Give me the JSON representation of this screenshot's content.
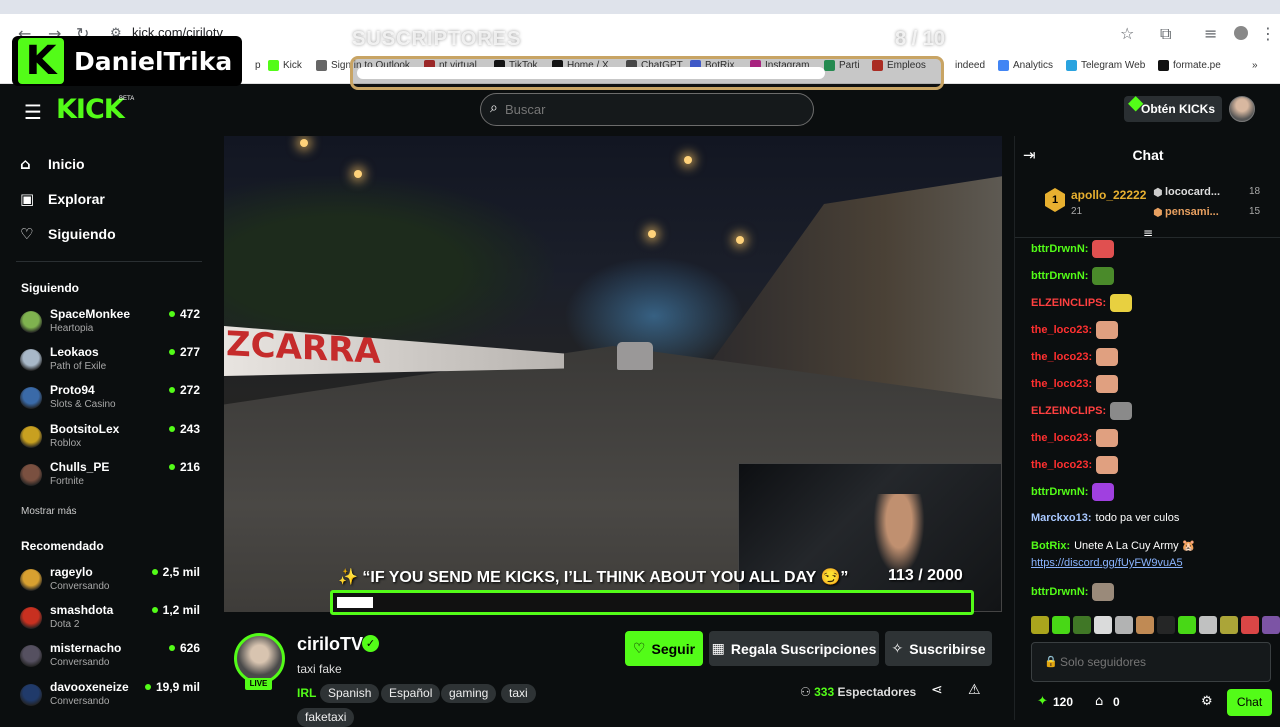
{
  "browser": {
    "url": "kick.com/cirilotv",
    "bookmarks": [
      {
        "label": "p",
        "color": "#ffffff"
      },
      {
        "label": "Kick",
        "color": "#53fc18"
      },
      {
        "label": "Sign in to Outlook",
        "color": "#666666"
      },
      {
        "label": "nt virtual",
        "color": "#c52b2b"
      },
      {
        "label": "TikTok",
        "color": "#111111"
      },
      {
        "label": "Home / X",
        "color": "#111111"
      },
      {
        "label": "ChatGPT",
        "color": "#555555"
      },
      {
        "label": "BotRix",
        "color": "#4a6cff"
      },
      {
        "label": "Instagram",
        "color": "#d6249f"
      },
      {
        "label": "Parti",
        "color": "#27ae60"
      },
      {
        "label": "Empleos",
        "color": "#d93025"
      },
      {
        "label": "indeed",
        "color": "#ffffff"
      },
      {
        "label": "Analytics",
        "color": "#4285f4"
      },
      {
        "label": "Telegram Web",
        "color": "#2aa3df"
      },
      {
        "label": "formate.pe",
        "color": "#111111"
      }
    ]
  },
  "overlay": {
    "logo_letter": "K",
    "streamer_name": "DanielTrika",
    "subs_label": "SUSCRIPTORES",
    "subs_count": "8  / 10",
    "subs_progress": 0.8,
    "goal_text": "✨ “IF YOU SEND ME KICKS, I’LL THINK ABOUT YOU ALL DAY 😏”",
    "goal_count": "113  / 2000",
    "goal_progress": 0.0565
  },
  "header": {
    "logo": "KICK",
    "beta": "BETA",
    "search_placeholder": "Buscar",
    "get_kicks": "Obtén KICKs"
  },
  "sidebar": {
    "nav": [
      {
        "icon": "home-icon",
        "label": "Inicio"
      },
      {
        "icon": "compass-icon",
        "label": "Explorar"
      },
      {
        "icon": "heart-icon",
        "label": "Siguiendo"
      }
    ],
    "following_title": "Siguiendo",
    "following": [
      {
        "name": "SpaceMonkee",
        "category": "Heartopia",
        "viewers": "472",
        "color": "#7fb24f"
      },
      {
        "name": "Leokaos",
        "category": "Path of Exile",
        "viewers": "277",
        "color": "#a8b8c8"
      },
      {
        "name": "Proto94",
        "category": "Slots & Casino",
        "viewers": "272",
        "color": "#3a6aa8"
      },
      {
        "name": "BootsitoLex",
        "category": "Roblox",
        "viewers": "243",
        "color": "#c8a020"
      },
      {
        "name": "Chulls_PE",
        "category": "Fortnite",
        "viewers": "216",
        "color": "#7a5040"
      }
    ],
    "show_more": "Mostrar más",
    "recommended_title": "Recomendado",
    "recommended": [
      {
        "name": "rageylo",
        "category": "Conversando",
        "viewers": "2,5 mil",
        "color": "#d8a030"
      },
      {
        "name": "smashdota",
        "category": "Dota 2",
        "viewers": "1,2 mil",
        "color": "#c83020"
      },
      {
        "name": "misternacho",
        "category": "Conversando",
        "viewers": "626",
        "color": "#555060"
      },
      {
        "name": "davooxeneize",
        "category": "Conversando",
        "viewers": "19,9 mil",
        "color": "#203a6a"
      }
    ]
  },
  "video": {
    "wall_text": "ZCARRA"
  },
  "channel": {
    "name": "ciriloTV",
    "live": "LIVE",
    "title": "taxi fake",
    "category": "IRL",
    "tags": [
      "Spanish",
      "Español",
      "gaming",
      "taxi",
      "faketaxi"
    ],
    "follow": "Seguir",
    "gift_subs": "Regala Suscripciones",
    "subscribe": "Suscribirse",
    "viewers": "333",
    "viewers_label": "Espectadores"
  },
  "chat": {
    "title": "Chat",
    "leaderboard": [
      {
        "rank": "1",
        "name": "apollo_22222",
        "amount": "21"
      },
      {
        "name": "lococard...",
        "amount": "18"
      },
      {
        "name": "pensami...",
        "amount": "15"
      }
    ],
    "messages": [
      {
        "user": "bttrDrwnN:",
        "text": "",
        "color": "#53fc18",
        "emote": "#e05050"
      },
      {
        "user": "bttrDrwnN:",
        "text": "",
        "color": "#53fc18",
        "emote": "#4a8a2a"
      },
      {
        "user": "ELZEINCLIPS:",
        "text": "",
        "color": "#ff4040",
        "emote": "#e8d040"
      },
      {
        "user": "the_loco23:",
        "text": "",
        "color": "#ff3030",
        "emote": "#e0a080"
      },
      {
        "user": "the_loco23:",
        "text": "",
        "color": "#ff3030",
        "emote": "#e0a080"
      },
      {
        "user": "the_loco23:",
        "text": "",
        "color": "#ff3030",
        "emote": "#e0a080"
      },
      {
        "user": "ELZEINCLIPS:",
        "text": "",
        "color": "#ff4040",
        "emote": "#8a8a8a"
      },
      {
        "user": "the_loco23:",
        "text": "",
        "color": "#ff3030",
        "emote": "#e0a080"
      },
      {
        "user": "the_loco23:",
        "text": "",
        "color": "#ff3030",
        "emote": "#e0a080"
      },
      {
        "user": "bttrDrwnN:",
        "text": "",
        "color": "#53fc18",
        "emote": "#a040e0"
      },
      {
        "user": "Marckxo13:",
        "text": "todo pa ver culos",
        "color": "#a8c8ff",
        "emote": ""
      },
      {
        "user": "BotRix:",
        "text": "Unete A La Cuy Army 🐹",
        "color": "#53fc18",
        "emote": ""
      },
      {
        "user": "",
        "text": "https://discord.gg/fUyFW9vuA5",
        "color": "#ffffff",
        "emote": ""
      },
      {
        "user": "bttrDrwnN:",
        "text": "",
        "color": "#53fc18",
        "emote": "#9a8a7a"
      }
    ],
    "input_placeholder": "Solo seguidores",
    "kicks_count": "120",
    "store_count": "0",
    "send": "Chat"
  }
}
